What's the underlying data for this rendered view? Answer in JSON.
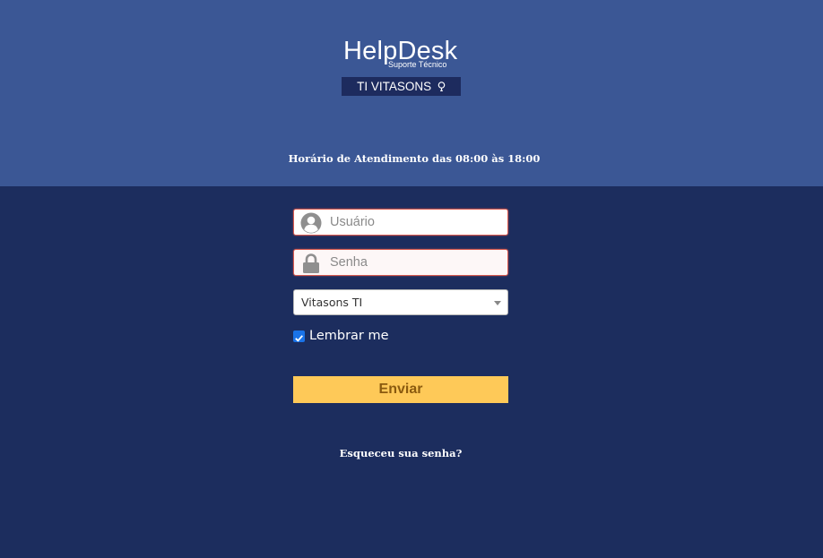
{
  "branding": {
    "title": "HelpDesk",
    "subtitle": "Suporte Técnico",
    "band_label": "TI VITASONS",
    "band_icon": "lightbulb-icon"
  },
  "hours_text": "Horário de Atendimento das 08:00 às 18:00",
  "form": {
    "username": {
      "placeholder": "Usuário",
      "value": "",
      "icon": "user-icon"
    },
    "password": {
      "placeholder": "Senha",
      "value": "",
      "icon": "lock-icon"
    },
    "company_select": {
      "selected": "Vitasons TI"
    },
    "remember": {
      "label": "Lembrar me",
      "checked": true
    },
    "submit_label": "Enviar",
    "forgot_label": "Esqueceu sua senha?"
  },
  "colors": {
    "header_bg": "#3b5795",
    "page_bg": "#1c2d5e",
    "button_bg": "#fec958",
    "button_text": "#8a5a0f",
    "field_error_border": "#d95a4f"
  }
}
